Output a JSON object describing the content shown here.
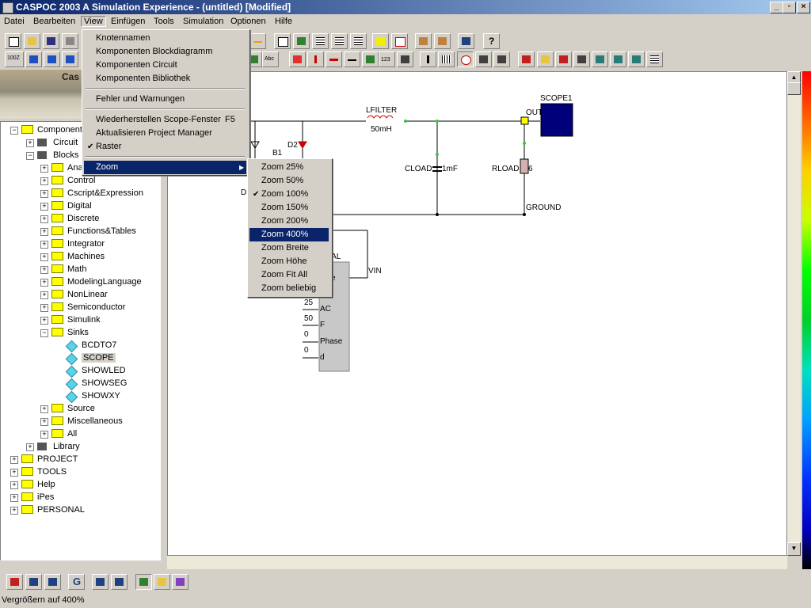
{
  "window": {
    "title": "CASPOC 2003 A Simulation Experience - (untitled) [Modified]"
  },
  "menubar": [
    "Datei",
    "Bearbeiten",
    "View",
    "Einfügen",
    "Tools",
    "Simulation",
    "Optionen",
    "Hilfe"
  ],
  "logo_text": "Cas",
  "view_menu": {
    "items": [
      "Knotennamen",
      "Komponenten Blockdiagramm",
      "Komponenten Circuit",
      "Komponenten Bibliothek",
      "Fehler und Warnungen",
      "Wiederherstellen Scope-Fenster",
      "Aktualisieren Project Manager",
      "Raster",
      "Zoom"
    ],
    "shortcut_restore": "F5"
  },
  "zoom_menu": {
    "items": [
      "Zoom 25%",
      "Zoom 50%",
      "Zoom 100%",
      "Zoom 150%",
      "Zoom 200%",
      "Zoom 400%",
      "Zoom Breite",
      "Zoom Höhe",
      "Zoom Fit All",
      "Zoom beliebig"
    ],
    "checked": "Zoom 100%",
    "highlighted": "Zoom 400%"
  },
  "tree": {
    "root": "Components",
    "circuit": "Circuit",
    "blocks": "Blocks",
    "block_folders": [
      "Ana",
      "Control",
      "Cscript&Expression",
      "Digital",
      "Discrete",
      "Functions&Tables",
      "Integrator",
      "Machines",
      "Math",
      "ModelingLanguage",
      "NonLinear",
      "Semiconductor",
      "Simulink",
      "Sinks"
    ],
    "sinks_items": [
      "BCDTO7",
      "SCOPE",
      "SHOWLED",
      "SHOWSEG",
      "SHOWXY"
    ],
    "after_sinks": [
      "Source",
      "Miscellaneous",
      "All"
    ],
    "library": "Library",
    "top_level": [
      "PROJECT",
      "TOOLS",
      "Help",
      "iPes",
      "PERSONAL"
    ]
  },
  "schematic": {
    "lfilter": "LFILTER",
    "lfilter_val": "50mH",
    "scope": "SCOPE1",
    "out": "OUT",
    "cload": "CLOAD",
    "cload_val": "1mF",
    "rload": "RLOAD",
    "rload_val": "6",
    "ground": "GROUND",
    "d2": "D2",
    "b1": "B1",
    "d": "D",
    "vin": "VIN",
    "nal": "NAL",
    "e": "e",
    "params": [
      {
        "value": "25",
        "label": "AC"
      },
      {
        "value": "50",
        "label": "F"
      },
      {
        "value": "0",
        "label": "Phase"
      },
      {
        "value": "0",
        "label": "d"
      }
    ]
  },
  "status": "Vergrößern auf 400%"
}
